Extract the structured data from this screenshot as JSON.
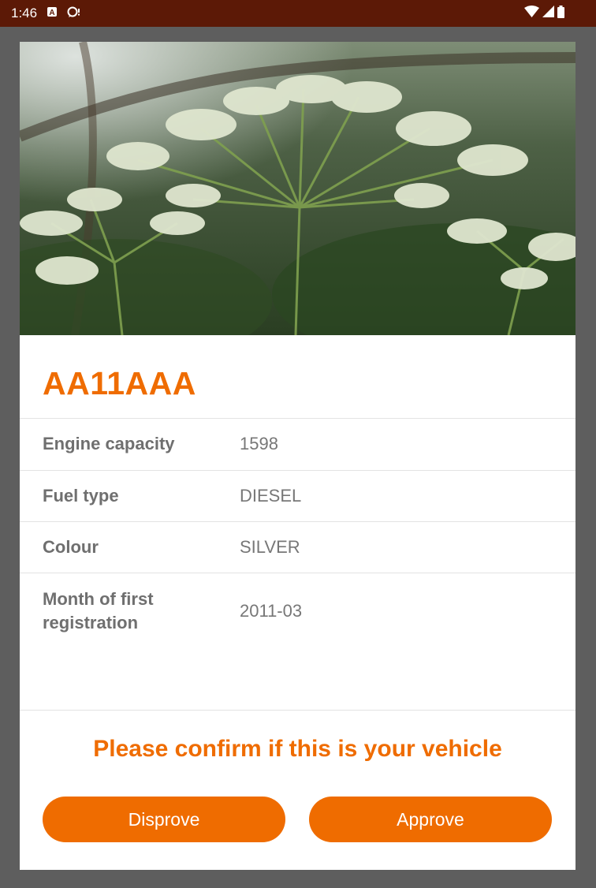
{
  "status_bar": {
    "time": "1:46",
    "left_icons": [
      "notification-a-icon",
      "notification-bubble-icon"
    ],
    "right_icons": [
      "wifi-icon",
      "signal-icon",
      "battery-icon"
    ]
  },
  "vehicle": {
    "image": "hero-plant-photo",
    "registration": "AA11AAA",
    "details": [
      {
        "label": "Engine capacity",
        "value": "1598"
      },
      {
        "label": "Fuel type",
        "value": "DIESEL"
      },
      {
        "label": "Colour",
        "value": "SILVER"
      },
      {
        "label": "Month of first registration",
        "value": "2011-03"
      }
    ]
  },
  "confirm": {
    "prompt": "Please confirm if this is your vehicle",
    "disprove_label": "Disprove",
    "approve_label": "Approve"
  },
  "colors": {
    "accent": "#ef6c00",
    "status_bar": "#5c1906",
    "label_text": "#6f6f6f",
    "value_text": "#777777"
  }
}
